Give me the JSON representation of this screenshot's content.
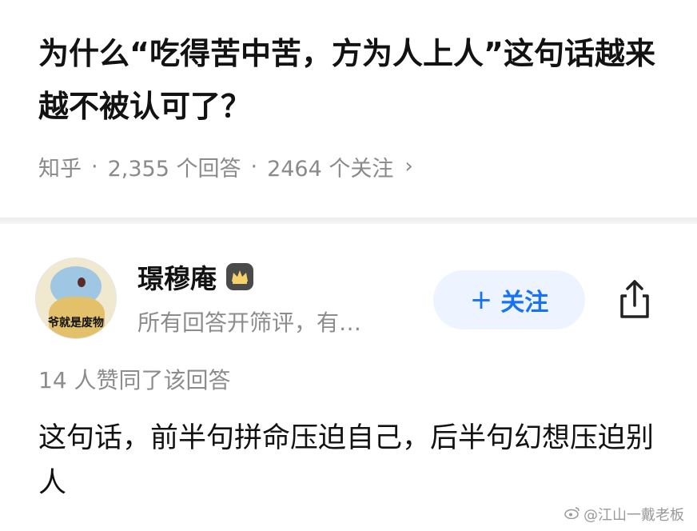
{
  "question": {
    "title": "为什么“吃得苦中苦，方为人上人”这句话越来越不被认可了？",
    "source": "知乎",
    "answers_count": "2,355 个回答",
    "followers_count": "2464 个关注",
    "sep": "·",
    "chevron": "›"
  },
  "answerer": {
    "name": "璟穆庵",
    "badge_icon": "crown-icon",
    "avatar_text": "爷就是废物",
    "subtitle": "所有回答开筛评，有…",
    "follow_plus": "+",
    "follow_label": "关注",
    "share_icon": "share-icon"
  },
  "answer": {
    "likes": "14 人赞同了该回答",
    "content": "这句话，前半句拼命压迫自己，后半句幻想压迫别人"
  },
  "watermark": {
    "icon": "weibo-icon",
    "text": "@江山一戴老板"
  },
  "colors": {
    "accent": "#1772f6",
    "follow_bg": "#eef4ff",
    "meta_gray": "#8c8c8c"
  }
}
